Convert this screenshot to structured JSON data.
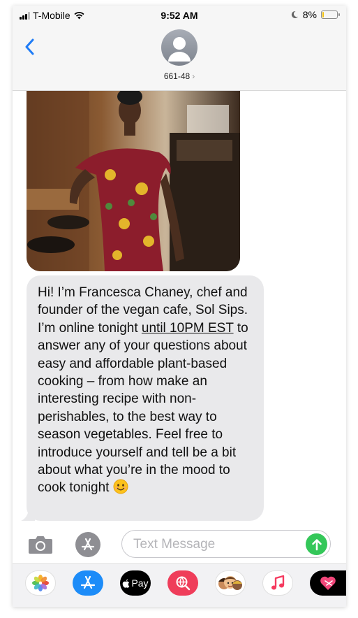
{
  "status_bar": {
    "carrier": "T-Mobile",
    "time": "9:52 AM",
    "battery_percent": "8%",
    "battery_level": 0.08
  },
  "header": {
    "contact_name": "661-48",
    "back_icon": "chevron-left-icon",
    "avatar_icon": "person-placeholder-icon"
  },
  "thread": {
    "photo_icon": "photo-attachment",
    "message_parts": {
      "before_link": "Hi! I’m Francesca Chaney, chef and founder of the vegan cafe, Sol Sips. I’m online tonight ",
      "link": "until 10PM EST",
      "after_link": " to answer any of your questions about easy and affordable plant-based cooking – from how make an interesting recipe with non-perishables, to the best way to season vegetables. Feel free to introduce yourself and tell be a bit about what you’re in the mood to cook tonight ",
      "emoji": "smiling-face-emoji"
    }
  },
  "compose": {
    "placeholder": "Text Message",
    "camera_icon": "camera-icon",
    "apps_icon": "app-store-icon",
    "send_icon": "send-arrow-icon"
  },
  "app_drawer": {
    "apps": [
      "photos",
      "app-store",
      "apple-pay",
      "search-images",
      "memoji",
      "music",
      "digital-touch"
    ],
    "apple_pay_label": "Pay"
  },
  "colors": {
    "accent_blue": "#1f7cf6",
    "bubble_gray": "#e9e9eb",
    "send_green": "#34c759",
    "battery_yellow": "#f4c20d"
  }
}
